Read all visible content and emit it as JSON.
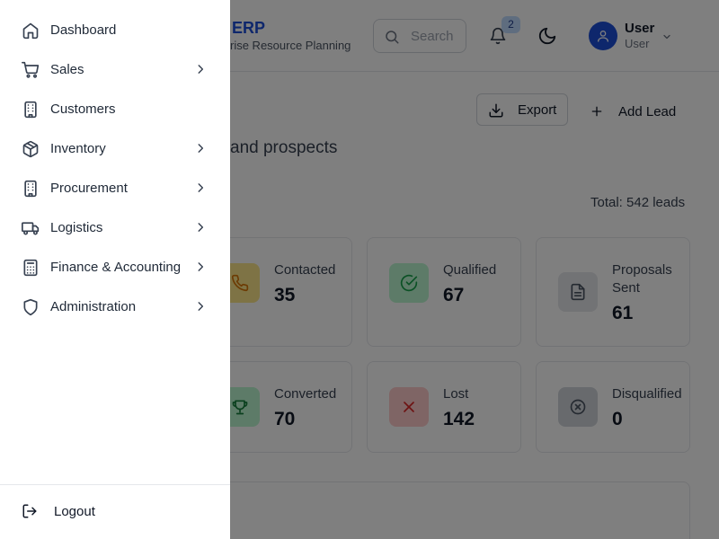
{
  "header": {
    "brand_title": "ERP",
    "brand_subtitle": "rise Resource Planning",
    "search_placeholder": "Search",
    "notification_count": "2",
    "user_name": "User",
    "user_role": "User"
  },
  "page": {
    "export_label": "Export",
    "add_lead_label": "Add Lead",
    "subtitle": "and prospects",
    "total_text": "Total: 542 leads"
  },
  "stats": [
    {
      "label": "Contacted",
      "value": "35",
      "icon": "phone-icon",
      "color": "#d97706"
    },
    {
      "label": "Qualified",
      "value": "67",
      "icon": "check-circle-icon",
      "color": "#16a34a"
    },
    {
      "label": "Proposals Sent",
      "value": "61",
      "icon": "document-icon",
      "color": "#4b5563"
    },
    {
      "label": "Converted",
      "value": "70",
      "icon": "trophy-icon",
      "color": "#15803d"
    },
    {
      "label": "Lost",
      "value": "142",
      "icon": "x-icon",
      "color": "#dc2626"
    },
    {
      "label": "Disqualified",
      "value": "0",
      "icon": "x-circle-icon",
      "color": "#4b5563"
    }
  ],
  "sidebar": {
    "items": [
      {
        "label": "Dashboard",
        "icon": "home-icon",
        "has_children": false
      },
      {
        "label": "Sales",
        "icon": "cart-icon",
        "has_children": true
      },
      {
        "label": "Customers",
        "icon": "building-icon",
        "has_children": false
      },
      {
        "label": "Inventory",
        "icon": "box-icon",
        "has_children": true
      },
      {
        "label": "Procurement",
        "icon": "building-icon",
        "has_children": true
      },
      {
        "label": "Logistics",
        "icon": "truck-icon",
        "has_children": true
      },
      {
        "label": "Finance & Accounting",
        "icon": "calculator-icon",
        "has_children": true
      },
      {
        "label": "Administration",
        "icon": "shield-icon",
        "has_children": true
      }
    ],
    "logout_label": "Logout"
  },
  "colors": {
    "brand": "#1d4ed8",
    "overlay": "rgba(0,0,0,0.5)"
  }
}
